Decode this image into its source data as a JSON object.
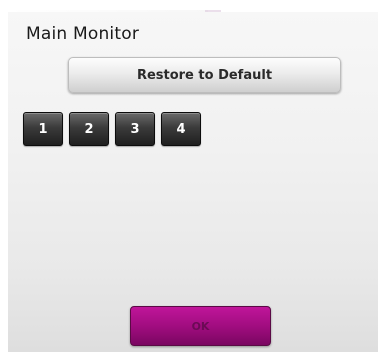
{
  "dialog": {
    "title": "Main Monitor",
    "restore_label": "Restore to Default",
    "monitors": [
      {
        "label": "1"
      },
      {
        "label": "2"
      },
      {
        "label": "3"
      },
      {
        "label": "4"
      }
    ],
    "ok_label": "OK"
  },
  "colors": {
    "ok_button": "#a10d80",
    "number_button": "#2e2e2e",
    "panel": "#f1f1f1"
  }
}
